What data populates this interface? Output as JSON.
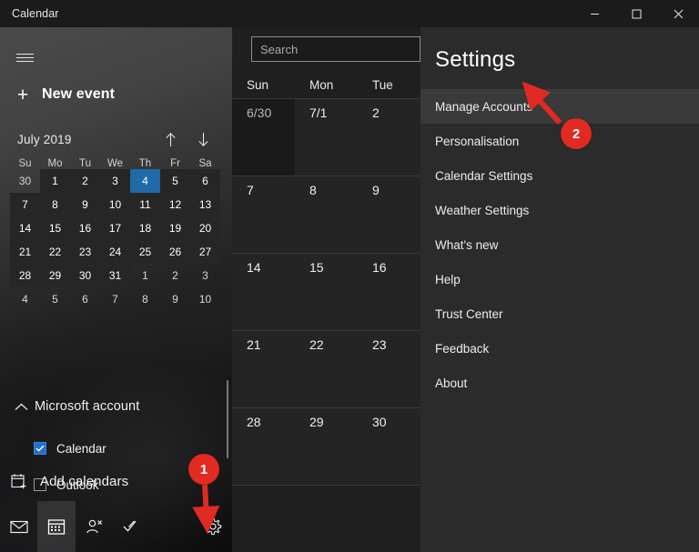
{
  "window": {
    "title": "Calendar",
    "controls": [
      {
        "name": "minimize",
        "glyph": "minimize-icon"
      },
      {
        "name": "maximize",
        "glyph": "maximize-icon"
      },
      {
        "name": "close",
        "glyph": "close-icon"
      }
    ]
  },
  "sidebar": {
    "menu_icon": "hamburger-icon",
    "new_event": {
      "icon": "plus-icon",
      "label": "New event"
    },
    "mini_calendar": {
      "title": "July 2019",
      "prev_icon": "arrow-up-icon",
      "next_icon": "arrow-down-icon",
      "weekday_headers": [
        "Su",
        "Mo",
        "Tu",
        "We",
        "Th",
        "Fr",
        "Sa"
      ],
      "selected_day": "4",
      "weeks": [
        [
          {
            "d": "30",
            "m": "out"
          },
          {
            "d": "1",
            "m": "in"
          },
          {
            "d": "2",
            "m": "in"
          },
          {
            "d": "3",
            "m": "in"
          },
          {
            "d": "4",
            "m": "sel"
          },
          {
            "d": "5",
            "m": "in"
          },
          {
            "d": "6",
            "m": "in"
          }
        ],
        [
          {
            "d": "7",
            "m": "in"
          },
          {
            "d": "8",
            "m": "in"
          },
          {
            "d": "9",
            "m": "in"
          },
          {
            "d": "10",
            "m": "in"
          },
          {
            "d": "11",
            "m": "in"
          },
          {
            "d": "12",
            "m": "in"
          },
          {
            "d": "13",
            "m": "in"
          }
        ],
        [
          {
            "d": "14",
            "m": "in"
          },
          {
            "d": "15",
            "m": "in"
          },
          {
            "d": "16",
            "m": "in"
          },
          {
            "d": "17",
            "m": "in"
          },
          {
            "d": "18",
            "m": "in"
          },
          {
            "d": "19",
            "m": "in"
          },
          {
            "d": "20",
            "m": "in"
          }
        ],
        [
          {
            "d": "21",
            "m": "in"
          },
          {
            "d": "22",
            "m": "in"
          },
          {
            "d": "23",
            "m": "in"
          },
          {
            "d": "24",
            "m": "in"
          },
          {
            "d": "25",
            "m": "in"
          },
          {
            "d": "26",
            "m": "in"
          },
          {
            "d": "27",
            "m": "in"
          }
        ],
        [
          {
            "d": "28",
            "m": "in"
          },
          {
            "d": "29",
            "m": "in"
          },
          {
            "d": "30",
            "m": "in"
          },
          {
            "d": "31",
            "m": "in"
          },
          {
            "d": "1",
            "m": "out"
          },
          {
            "d": "2",
            "m": "out"
          },
          {
            "d": "3",
            "m": "out"
          }
        ],
        [
          {
            "d": "4",
            "m": "out"
          },
          {
            "d": "5",
            "m": "out"
          },
          {
            "d": "6",
            "m": "out"
          },
          {
            "d": "7",
            "m": "out"
          },
          {
            "d": "8",
            "m": "out"
          },
          {
            "d": "9",
            "m": "out"
          },
          {
            "d": "10",
            "m": "out"
          }
        ]
      ]
    },
    "account": {
      "collapse_icon": "chevron-up-icon",
      "name": "Microsoft account",
      "calendars": [
        {
          "label": "Calendar",
          "checked": true
        },
        {
          "label": "Outlook",
          "checked": false
        }
      ]
    },
    "add_calendars": {
      "icon": "calendar-add-icon",
      "label": "Add calendars"
    },
    "nav": [
      {
        "name": "mail",
        "icon": "mail-icon",
        "active": false
      },
      {
        "name": "calendar",
        "icon": "calendar-icon",
        "active": true
      },
      {
        "name": "people",
        "icon": "people-icon",
        "active": false
      },
      {
        "name": "todo",
        "icon": "check-icon",
        "active": false
      },
      {
        "name": "settings",
        "icon": "gear-icon",
        "active": false
      }
    ]
  },
  "center": {
    "search": {
      "placeholder": "Search",
      "value": ""
    },
    "weekday_headers": [
      "Sun",
      "Mon",
      "Tue"
    ],
    "weeks": [
      [
        {
          "d": "6/30",
          "m": "prev"
        },
        {
          "d": "7/1",
          "m": "cur"
        },
        {
          "d": "2",
          "m": "cur"
        }
      ],
      [
        {
          "d": "7",
          "m": "cur"
        },
        {
          "d": "8",
          "m": "cur"
        },
        {
          "d": "9",
          "m": "cur"
        }
      ],
      [
        {
          "d": "14",
          "m": "cur"
        },
        {
          "d": "15",
          "m": "cur"
        },
        {
          "d": "16",
          "m": "cur"
        }
      ],
      [
        {
          "d": "21",
          "m": "cur"
        },
        {
          "d": "22",
          "m": "cur"
        },
        {
          "d": "23",
          "m": "cur"
        }
      ],
      [
        {
          "d": "28",
          "m": "cur"
        },
        {
          "d": "29",
          "m": "cur"
        },
        {
          "d": "30",
          "m": "cur"
        }
      ]
    ]
  },
  "settings": {
    "title": "Settings",
    "items": [
      {
        "label": "Manage Accounts",
        "highlighted": true
      },
      {
        "label": "Personalisation",
        "highlighted": false
      },
      {
        "label": "Calendar Settings",
        "highlighted": false
      },
      {
        "label": "Weather Settings",
        "highlighted": false
      },
      {
        "label": "What's new",
        "highlighted": false
      },
      {
        "label": "Help",
        "highlighted": false
      },
      {
        "label": "Trust Center",
        "highlighted": false
      },
      {
        "label": "Feedback",
        "highlighted": false
      },
      {
        "label": "About",
        "highlighted": false
      }
    ]
  },
  "callouts": [
    {
      "number": "1",
      "color": "#e02a22"
    },
    {
      "number": "2",
      "color": "#e02a22"
    }
  ]
}
